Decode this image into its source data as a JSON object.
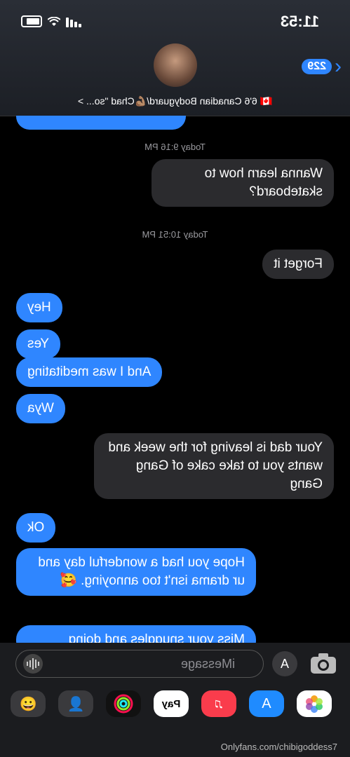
{
  "status_bar": {
    "time": "11:53"
  },
  "header": {
    "unread_count": "229",
    "contact_name": "🇨🇦 6'6 Canadian Bodyguard/💪🏽Chad \"so... >"
  },
  "messages": [
    {
      "type": "timestamp",
      "text": "Today 9:16 PM"
    },
    {
      "type": "received",
      "text": "Wanna learn how to skateboard?"
    },
    {
      "type": "timestamp",
      "text": "Today 10:51 PM"
    },
    {
      "type": "received",
      "text": "Forget it"
    },
    {
      "type": "sent",
      "text": "Hey"
    },
    {
      "type": "sent",
      "text": "Yes"
    },
    {
      "type": "sent",
      "text": "And I was meditating"
    },
    {
      "type": "sent",
      "text": "Wya"
    },
    {
      "type": "received",
      "text": "Your dad is leaving for the week and wants you to take cake of Gang Gang"
    },
    {
      "type": "sent",
      "text": "Ok"
    },
    {
      "type": "sent",
      "text": "Hope you had a wonderful day and ur drama isn't too annoying. 🥰"
    },
    {
      "type": "sent",
      "text": "Miss your snuggles and doing"
    }
  ],
  "input": {
    "placeholder": "iMessage"
  },
  "app_drawer": {
    "items": [
      "Photos",
      "App Store",
      "Music",
      "Apple Pay",
      "Activity",
      "Memoji",
      "Animoji"
    ],
    "pay_label": "Pay"
  },
  "watermark": "Onlyfans.com/chibigoddess7"
}
